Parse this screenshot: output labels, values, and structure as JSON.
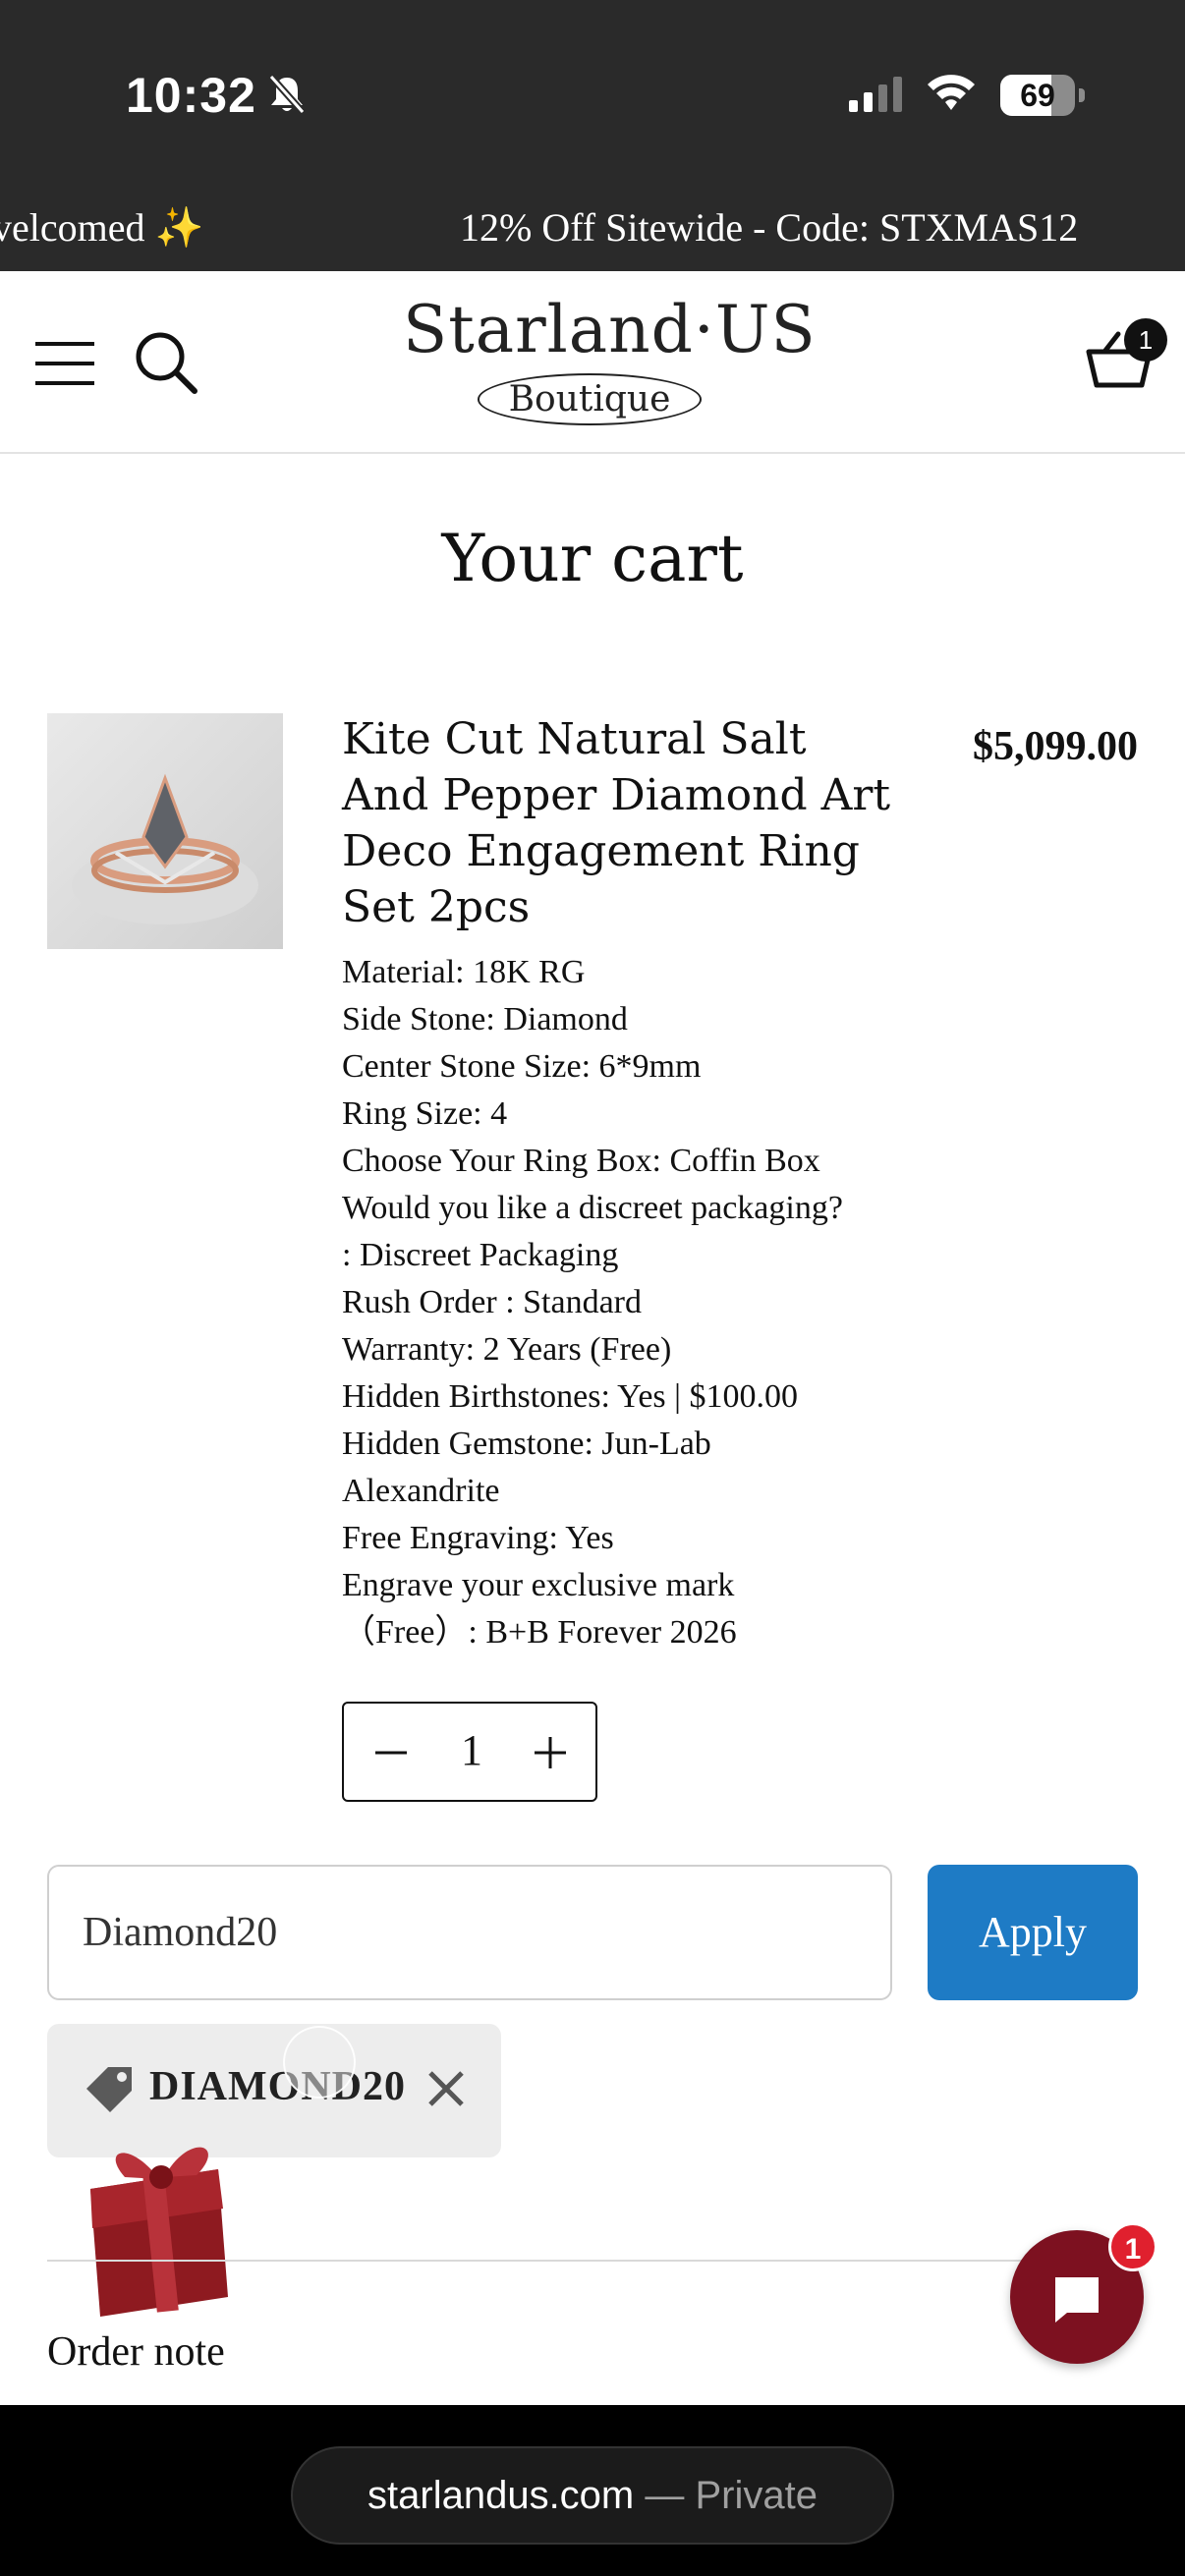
{
  "status": {
    "time": "10:32",
    "battery": "69",
    "battery_level": 0.69
  },
  "promo": {
    "left_text": "velcomed ✨",
    "right_text": "12% Off Sitewide - Code: STXMAS12"
  },
  "header": {
    "logo_name": "Starland·US",
    "logo_sub": "Boutique",
    "cart_count": "1"
  },
  "cart": {
    "title": "Your cart",
    "item": {
      "title": "Kite Cut Natural Salt And Pepper Diamond Art Deco Engagement Ring Set 2pcs",
      "price": "$5,099.00",
      "options": [
        "Material: 18K RG",
        "Side Stone: Diamond",
        "Center Stone Size: 6*9mm",
        "Ring Size: 4",
        "Choose Your Ring Box: Coffin Box",
        "Would you like a discreet packaging?",
        ": Discreet Packaging",
        "Rush Order : Standard",
        "Warranty: 2 Years (Free)",
        "Hidden Birthstones: Yes | $100.00",
        "Hidden Gemstone: Jun-Lab",
        "Alexandrite",
        "Free Engraving: Yes",
        "Engrave your exclusive mark",
        "（Free）: B+B Forever 2026"
      ],
      "quantity": "1"
    },
    "discount": {
      "input_value": "Diamond20",
      "apply_label": "Apply",
      "applied_code": "DIAMOND20"
    },
    "order_note_label": "Order note"
  },
  "chat": {
    "badge": "1"
  },
  "browser": {
    "domain": "starlandus.com",
    "suffix": " — Private"
  },
  "colors": {
    "apply_blue": "#1e7bc5",
    "chat_maroon": "#7d1120",
    "badge_red": "#e0202e",
    "dark_bar": "#2a2a2a"
  }
}
